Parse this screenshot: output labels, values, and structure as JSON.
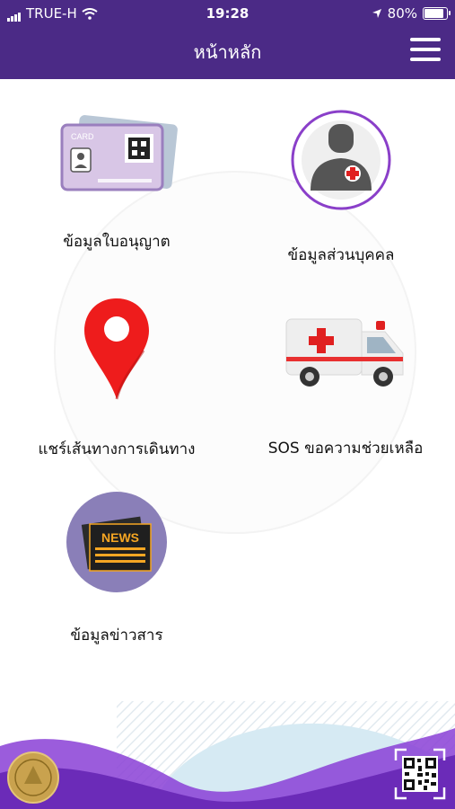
{
  "status_bar": {
    "carrier": "TRUE-H",
    "time": "19:28",
    "battery": "80%"
  },
  "header": {
    "title": "หน้าหลัก"
  },
  "menu": {
    "license": {
      "label": "ข้อมูลใบอนุญาต",
      "card_text": "CARD"
    },
    "personal": {
      "label": "ข้อมูลส่วนบุคคล"
    },
    "route": {
      "label": "แชร์เส้นทางการเดินทาง"
    },
    "sos": {
      "label": "SOS  ขอความช่วยเหลือ"
    },
    "news": {
      "label": "ข้อมูลข่าวสาร",
      "badge": "NEWS"
    }
  },
  "colors": {
    "primary": "#4b2a86",
    "accent_purple": "#8a3fc9",
    "pin_red": "#ee1c1c",
    "news_circle": "#8a7fb8"
  }
}
